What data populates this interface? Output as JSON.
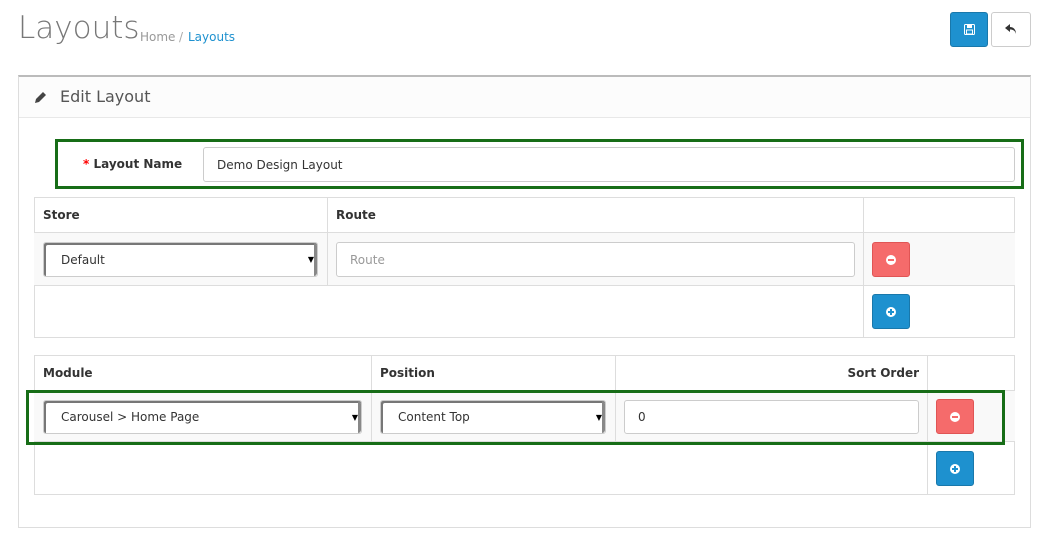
{
  "header": {
    "title": "Layouts",
    "breadcrumb": [
      {
        "label": "Home"
      },
      {
        "label": "Layouts"
      }
    ],
    "save_icon": "save-icon",
    "back_icon": "reply-icon"
  },
  "panel": {
    "title": "Edit Layout",
    "icon": "pencil-icon"
  },
  "form": {
    "required_mark": "*",
    "layout_name_label": "Layout Name",
    "layout_name_value": "Demo Design Layout"
  },
  "routes_table": {
    "headers": [
      "Store",
      "Route",
      ""
    ],
    "rows": [
      {
        "store": "Default",
        "route_placeholder": "Route"
      }
    ]
  },
  "modules_table": {
    "headers": [
      "Module",
      "Position",
      "Sort Order",
      ""
    ],
    "rows": [
      {
        "module": "Carousel > Home Page",
        "position": "Content Top",
        "sort_order": "0"
      }
    ]
  },
  "colors": {
    "primary": "#1e91cf",
    "danger": "#f56b6b",
    "highlight": "#176d17"
  }
}
